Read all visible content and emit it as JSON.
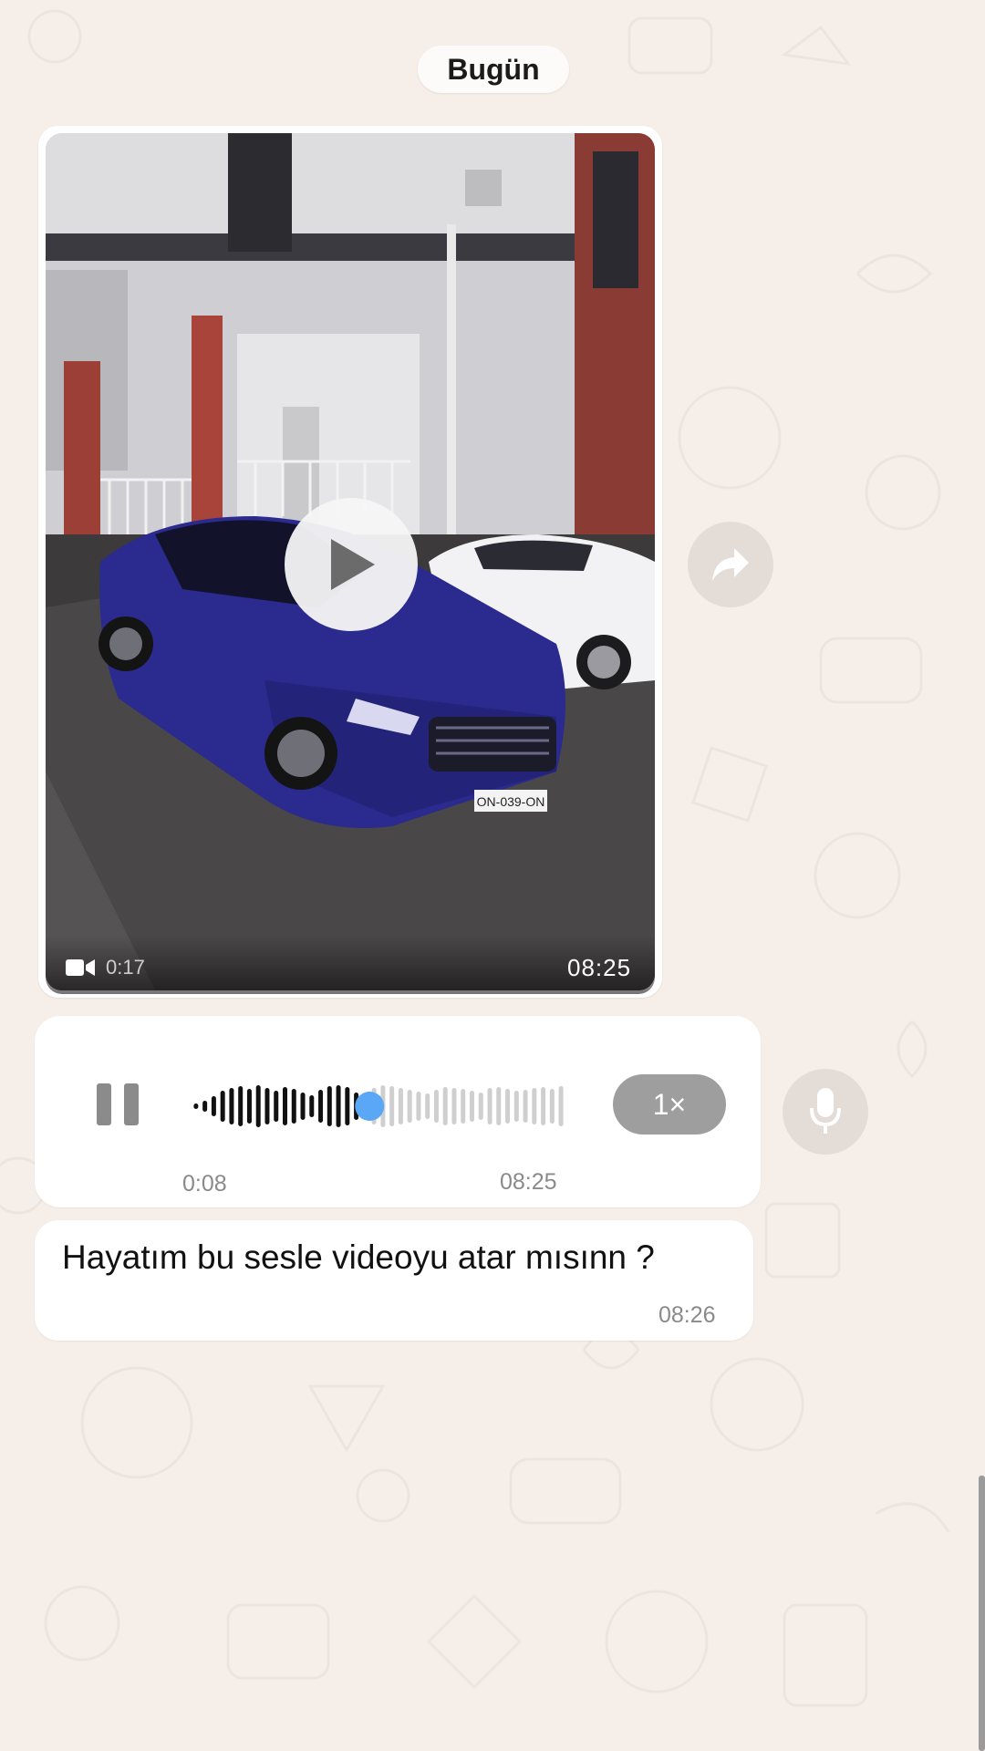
{
  "chat": {
    "day_label": "Bugün"
  },
  "video_message": {
    "duration_label": "0:17",
    "time": "08:25",
    "icons": {
      "camera": "video-camera-icon",
      "play": "play-icon",
      "forward": "forward-icon"
    },
    "plate": "ON-039-ON"
  },
  "voice_message": {
    "elapsed": "0:08",
    "time": "08:25",
    "speed": "1×",
    "progress": 0.48,
    "icons": {
      "pause": "pause-icon",
      "mic": "microphone-icon"
    },
    "colors": {
      "played": "#111111",
      "unplayed": "#cfcfcf",
      "thumb": "#5aa7f5"
    }
  },
  "text_message": {
    "text": "Hayatım bu sesle videoyu atar mısınn ?",
    "time": "08:26"
  }
}
